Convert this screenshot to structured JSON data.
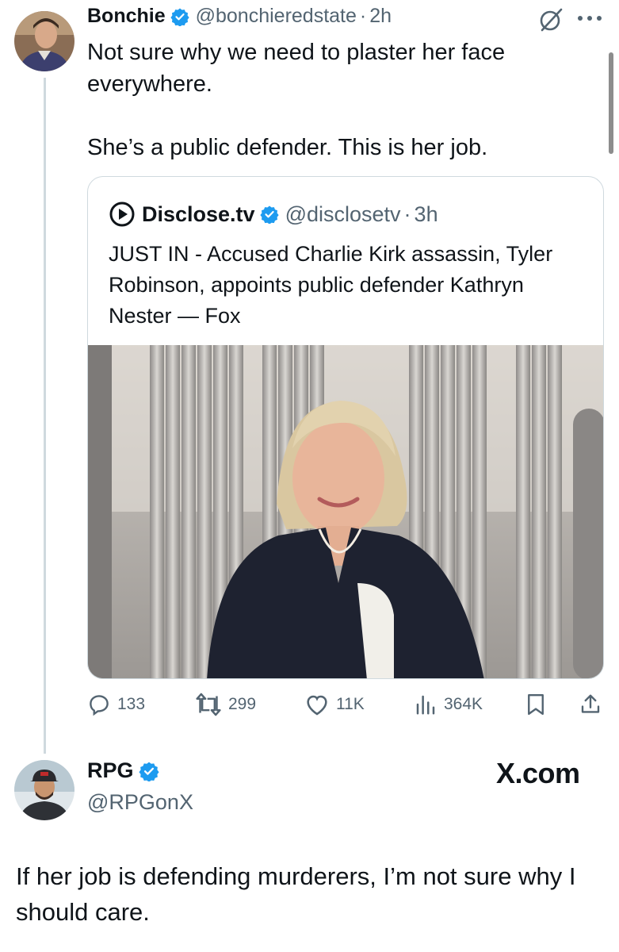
{
  "tweet": {
    "author_name": "Bonchie",
    "handle": "@bonchieredstate",
    "separator": "·",
    "time": "2h",
    "text_line1": "Not sure why we need to plaster her face everywhere.",
    "text_line2": "She’s a public defender. This is her job."
  },
  "quote": {
    "author_name": "Disclose.tv",
    "handle": "@disclosetv",
    "separator": "·",
    "time": "3h",
    "text": "JUST IN - Accused Charlie Kirk assassin, Tyler Robinson, appoints public defender Kathryn Nester — Fox"
  },
  "actions": {
    "replies": "133",
    "reposts": "299",
    "likes": "11K",
    "views": "364K"
  },
  "reply": {
    "author_name": "RPG",
    "handle": "@RPGonX",
    "watermark": "X.com",
    "text": "If her job is defending murderers, I’m not sure why I should care."
  },
  "colors": {
    "verified_blue": "#1d9bf0",
    "muted": "#536471",
    "border": "#cfd9de"
  },
  "icons": [
    "verified-badge-icon",
    "grok-icon",
    "more-icon",
    "disclose-logo-icon",
    "reply-icon",
    "repost-icon",
    "like-icon",
    "views-icon",
    "bookmark-icon",
    "share-icon"
  ]
}
